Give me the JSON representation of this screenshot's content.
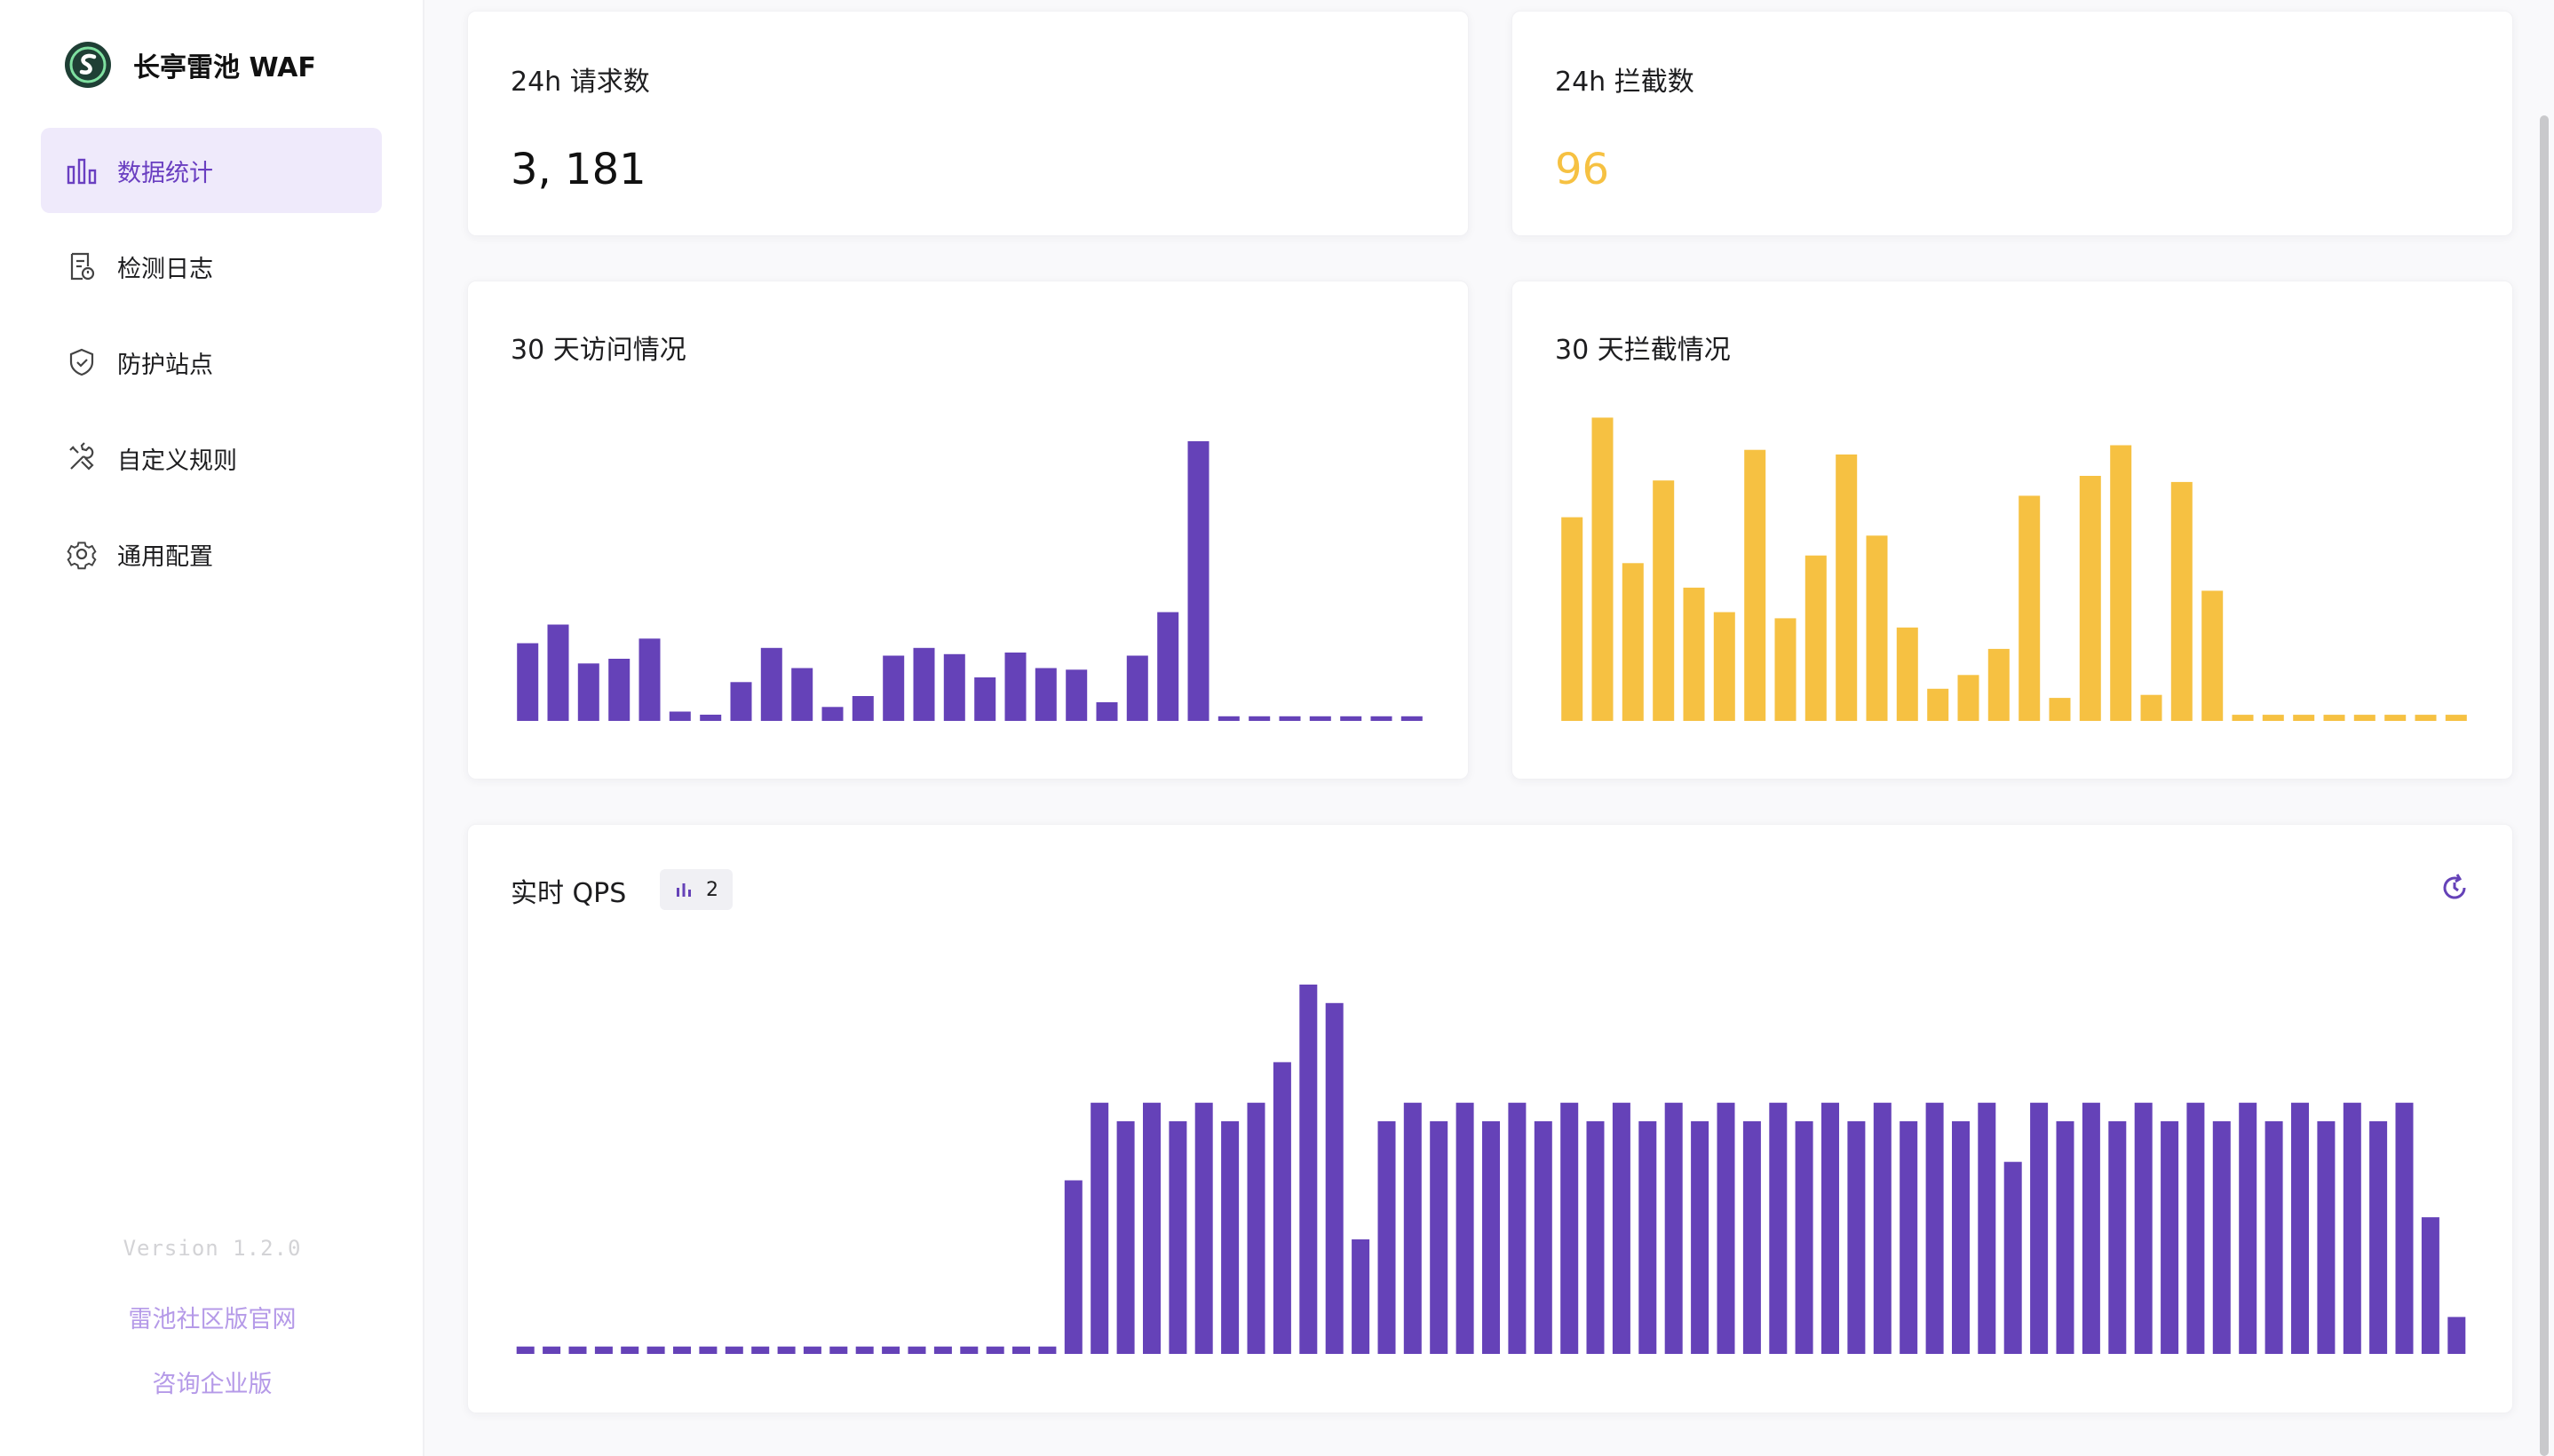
{
  "sidebar": {
    "app_title": "长亭雷池 WAF",
    "items": [
      {
        "label": "数据统计",
        "icon": "bar-chart-icon",
        "active": true
      },
      {
        "label": "检测日志",
        "icon": "log-icon"
      },
      {
        "label": "防护站点",
        "icon": "shield-icon"
      },
      {
        "label": "自定义规则",
        "icon": "tools-icon"
      },
      {
        "label": "通用配置",
        "icon": "gear-icon"
      }
    ],
    "version": "Version 1.2.0",
    "link_community": "雷池社区版官网",
    "link_enterprise": "咨询企业版"
  },
  "stats": {
    "requests_label": "24h 请求数",
    "requests_value": "3, 181",
    "blocked_label": "24h 拦截数",
    "blocked_value": "96"
  },
  "colors": {
    "purple": "#6542b8",
    "yellow": "#f6c142",
    "accent": "#6a3fc1"
  },
  "qps": {
    "title": "实时 QPS",
    "badge_count": "2",
    "refresh_icon": "refresh-icon"
  },
  "chart_data": [
    {
      "id": "visits",
      "type": "bar",
      "title": "30 天访问情况",
      "color": "#6542b8",
      "ylim": [
        0,
        180
      ],
      "values": [
        50,
        62,
        37,
        40,
        53,
        6,
        4,
        25,
        47,
        34,
        9,
        16,
        42,
        47,
        43,
        28,
        44,
        34,
        33,
        12,
        42,
        70,
        180,
        3,
        3,
        3,
        3,
        3,
        3,
        3
      ]
    },
    {
      "id": "blocked",
      "type": "bar",
      "title": "30 天拦截情况",
      "color": "#f6c142",
      "ylim": [
        0,
        200
      ],
      "values": [
        133,
        198,
        103,
        157,
        87,
        71,
        177,
        67,
        108,
        174,
        121,
        61,
        21,
        30,
        47,
        147,
        15,
        160,
        180,
        17,
        156,
        85,
        4,
        4,
        4,
        4,
        4,
        4,
        4,
        4
      ]
    },
    {
      "id": "qps",
      "type": "bar",
      "title": "实时 QPS",
      "color": "#6542b8",
      "ylim": [
        0,
        10
      ],
      "values": [
        0.2,
        0.2,
        0.2,
        0.2,
        0.2,
        0.2,
        0.2,
        0.2,
        0.2,
        0.2,
        0.2,
        0.2,
        0.2,
        0.2,
        0.2,
        0.2,
        0.2,
        0.2,
        0.2,
        0.2,
        0.2,
        4.7,
        6.8,
        6.3,
        6.8,
        6.3,
        6.8,
        6.3,
        6.8,
        7.9,
        10,
        9.5,
        3.1,
        6.3,
        6.8,
        6.3,
        6.8,
        6.3,
        6.8,
        6.3,
        6.8,
        6.3,
        6.8,
        6.3,
        6.8,
        6.3,
        6.8,
        6.3,
        6.8,
        6.3,
        6.8,
        6.3,
        6.8,
        6.3,
        6.8,
        6.3,
        6.8,
        5.2,
        6.8,
        6.3,
        6.8,
        6.3,
        6.8,
        6.3,
        6.8,
        6.3,
        6.8,
        6.3,
        6.8,
        6.3,
        6.8,
        6.3,
        6.8,
        3.7,
        1
      ]
    }
  ]
}
